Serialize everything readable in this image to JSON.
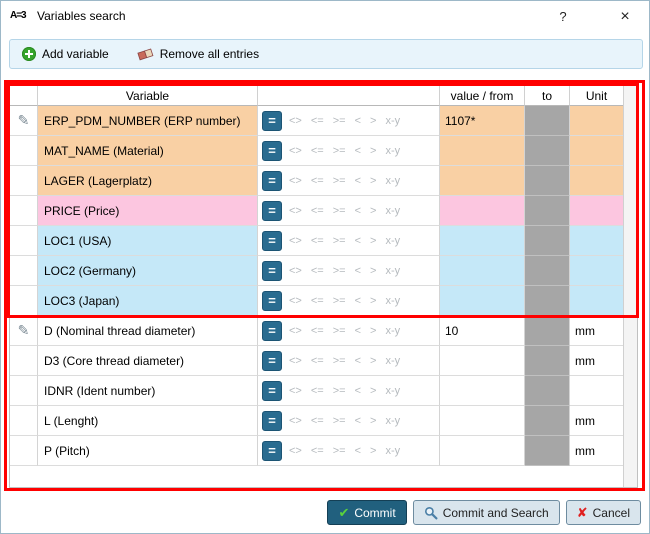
{
  "window": {
    "icon": "A=3",
    "title": "Variables search",
    "help": "?",
    "close": "×"
  },
  "toolbar": {
    "add_variable": "Add variable",
    "remove_all_entries": "Remove all entries"
  },
  "table": {
    "headers": {
      "variable": "Variable",
      "value_from": "value / from",
      "to": "to",
      "unit": "Unit"
    },
    "operators": [
      "=",
      "<>",
      "<=",
      ">=",
      "<",
      ">",
      "x-y"
    ],
    "selected_operator": "=",
    "rows": [
      {
        "variable": "ERP_PDM_NUMBER (ERP number)",
        "value": "1107*",
        "unit": "",
        "color": "#f9d0a4",
        "edit": true
      },
      {
        "variable": "MAT_NAME (Material)",
        "value": "",
        "unit": "",
        "color": "#f9d0a4",
        "edit": false
      },
      {
        "variable": "LAGER (Lagerplatz)",
        "value": "",
        "unit": "",
        "color": "#f9d0a4",
        "edit": false
      },
      {
        "variable": "PRICE (Price)",
        "value": "",
        "unit": "",
        "color": "#fcc6e0",
        "edit": false
      },
      {
        "variable": "LOC1 (USA)",
        "value": "",
        "unit": "",
        "color": "#c5e8f8",
        "edit": false
      },
      {
        "variable": "LOC2 (Germany)",
        "value": "",
        "unit": "",
        "color": "#c5e8f8",
        "edit": false
      },
      {
        "variable": "LOC3 (Japan)",
        "value": "",
        "unit": "",
        "color": "#c5e8f8",
        "edit": false
      },
      {
        "variable": "D (Nominal thread diameter)",
        "value": "10",
        "unit": "mm",
        "color": "#ffffff",
        "edit": true
      },
      {
        "variable": "D3 (Core thread diameter)",
        "value": "",
        "unit": "mm",
        "color": "#ffffff",
        "edit": false
      },
      {
        "variable": "IDNR (Ident number)",
        "value": "",
        "unit": "",
        "color": "#ffffff",
        "edit": false
      },
      {
        "variable": "L (Lenght)",
        "value": "",
        "unit": "mm",
        "color": "#ffffff",
        "edit": false
      },
      {
        "variable": "P (Pitch)",
        "value": "",
        "unit": "mm",
        "color": "#ffffff",
        "edit": false
      }
    ]
  },
  "footer": {
    "commit": "Commit",
    "commit_and_search": "Commit and Search",
    "cancel": "Cancel"
  },
  "icons": {
    "pencil": "✎",
    "check": "✔",
    "cross": "✘"
  },
  "colors": {
    "annotation": "#ff0000",
    "operator_selected_bg": "#2a6c90",
    "to_cell": "#a6a6a6",
    "commit_bg": "#21607e"
  }
}
